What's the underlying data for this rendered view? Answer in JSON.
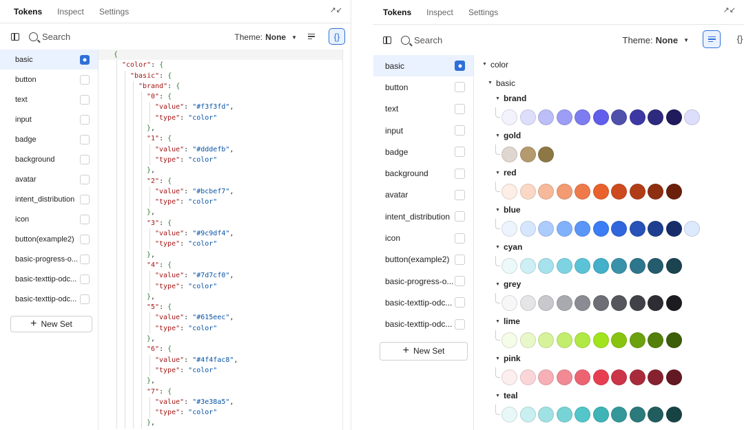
{
  "tabs": [
    "Tokens",
    "Inspect",
    "Settings"
  ],
  "toolbar": {
    "search_placeholder": "Search",
    "theme_label": "Theme:",
    "theme_value": "None"
  },
  "sets": [
    "basic",
    "button",
    "text",
    "input",
    "badge",
    "background",
    "avatar",
    "intent_distribution",
    "icon",
    "button(example2)",
    "basic-progress-o...",
    "basic-texttip-odc...",
    "basic-texttip-odc..."
  ],
  "active_set": "basic",
  "new_set_label": "New Set",
  "json_lines": [
    [
      {
        "t": "p",
        "v": "{"
      }
    ],
    [
      {
        "t": "k",
        "v": "\"color\""
      },
      {
        "t": "n",
        "v": ": "
      },
      {
        "t": "p",
        "v": "{"
      }
    ],
    [
      {
        "t": "k",
        "v": "\"basic\""
      },
      {
        "t": "n",
        "v": ": "
      },
      {
        "t": "p",
        "v": "{"
      }
    ],
    [
      {
        "t": "k",
        "v": "\"brand\""
      },
      {
        "t": "n",
        "v": ": "
      },
      {
        "t": "p",
        "v": "{"
      }
    ],
    [
      {
        "t": "k",
        "v": "\"0\""
      },
      {
        "t": "n",
        "v": ": "
      },
      {
        "t": "p",
        "v": "{"
      }
    ],
    [
      {
        "t": "k",
        "v": "\"value\""
      },
      {
        "t": "n",
        "v": ": "
      },
      {
        "t": "s",
        "v": "\"#f3f3fd\""
      },
      {
        "t": "n",
        "v": ","
      }
    ],
    [
      {
        "t": "k",
        "v": "\"type\""
      },
      {
        "t": "n",
        "v": ": "
      },
      {
        "t": "s",
        "v": "\"color\""
      }
    ],
    [
      {
        "t": "p",
        "v": "}"
      },
      {
        "t": "n",
        "v": ","
      }
    ],
    [
      {
        "t": "k",
        "v": "\"1\""
      },
      {
        "t": "n",
        "v": ": "
      },
      {
        "t": "p",
        "v": "{"
      }
    ],
    [
      {
        "t": "k",
        "v": "\"value\""
      },
      {
        "t": "n",
        "v": ": "
      },
      {
        "t": "s",
        "v": "\"#dddefb\""
      },
      {
        "t": "n",
        "v": ","
      }
    ],
    [
      {
        "t": "k",
        "v": "\"type\""
      },
      {
        "t": "n",
        "v": ": "
      },
      {
        "t": "s",
        "v": "\"color\""
      }
    ],
    [
      {
        "t": "p",
        "v": "}"
      },
      {
        "t": "n",
        "v": ","
      }
    ],
    [
      {
        "t": "k",
        "v": "\"2\""
      },
      {
        "t": "n",
        "v": ": "
      },
      {
        "t": "p",
        "v": "{"
      }
    ],
    [
      {
        "t": "k",
        "v": "\"value\""
      },
      {
        "t": "n",
        "v": ": "
      },
      {
        "t": "s",
        "v": "\"#bcbef7\""
      },
      {
        "t": "n",
        "v": ","
      }
    ],
    [
      {
        "t": "k",
        "v": "\"type\""
      },
      {
        "t": "n",
        "v": ": "
      },
      {
        "t": "s",
        "v": "\"color\""
      }
    ],
    [
      {
        "t": "p",
        "v": "}"
      },
      {
        "t": "n",
        "v": ","
      }
    ],
    [
      {
        "t": "k",
        "v": "\"3\""
      },
      {
        "t": "n",
        "v": ": "
      },
      {
        "t": "p",
        "v": "{"
      }
    ],
    [
      {
        "t": "k",
        "v": "\"value\""
      },
      {
        "t": "n",
        "v": ": "
      },
      {
        "t": "s",
        "v": "\"#9c9df4\""
      },
      {
        "t": "n",
        "v": ","
      }
    ],
    [
      {
        "t": "k",
        "v": "\"type\""
      },
      {
        "t": "n",
        "v": ": "
      },
      {
        "t": "s",
        "v": "\"color\""
      }
    ],
    [
      {
        "t": "p",
        "v": "}"
      },
      {
        "t": "n",
        "v": ","
      }
    ],
    [
      {
        "t": "k",
        "v": "\"4\""
      },
      {
        "t": "n",
        "v": ": "
      },
      {
        "t": "p",
        "v": "{"
      }
    ],
    [
      {
        "t": "k",
        "v": "\"value\""
      },
      {
        "t": "n",
        "v": ": "
      },
      {
        "t": "s",
        "v": "\"#7d7cf0\""
      },
      {
        "t": "n",
        "v": ","
      }
    ],
    [
      {
        "t": "k",
        "v": "\"type\""
      },
      {
        "t": "n",
        "v": ": "
      },
      {
        "t": "s",
        "v": "\"color\""
      }
    ],
    [
      {
        "t": "p",
        "v": "}"
      },
      {
        "t": "n",
        "v": ","
      }
    ],
    [
      {
        "t": "k",
        "v": "\"5\""
      },
      {
        "t": "n",
        "v": ": "
      },
      {
        "t": "p",
        "v": "{"
      }
    ],
    [
      {
        "t": "k",
        "v": "\"value\""
      },
      {
        "t": "n",
        "v": ": "
      },
      {
        "t": "s",
        "v": "\"#615eec\""
      },
      {
        "t": "n",
        "v": ","
      }
    ],
    [
      {
        "t": "k",
        "v": "\"type\""
      },
      {
        "t": "n",
        "v": ": "
      },
      {
        "t": "s",
        "v": "\"color\""
      }
    ],
    [
      {
        "t": "p",
        "v": "}"
      },
      {
        "t": "n",
        "v": ","
      }
    ],
    [
      {
        "t": "k",
        "v": "\"6\""
      },
      {
        "t": "n",
        "v": ": "
      },
      {
        "t": "p",
        "v": "{"
      }
    ],
    [
      {
        "t": "k",
        "v": "\"value\""
      },
      {
        "t": "n",
        "v": ": "
      },
      {
        "t": "s",
        "v": "\"#4f4fac8\""
      },
      {
        "t": "n",
        "v": ","
      }
    ],
    [
      {
        "t": "k",
        "v": "\"type\""
      },
      {
        "t": "n",
        "v": ": "
      },
      {
        "t": "s",
        "v": "\"color\""
      }
    ],
    [
      {
        "t": "p",
        "v": "}"
      },
      {
        "t": "n",
        "v": ","
      }
    ],
    [
      {
        "t": "k",
        "v": "\"7\""
      },
      {
        "t": "n",
        "v": ": "
      },
      {
        "t": "p",
        "v": "{"
      }
    ],
    [
      {
        "t": "k",
        "v": "\"value\""
      },
      {
        "t": "n",
        "v": ": "
      },
      {
        "t": "s",
        "v": "\"#3e38a5\""
      },
      {
        "t": "n",
        "v": ","
      }
    ],
    [
      {
        "t": "k",
        "v": "\"type\""
      },
      {
        "t": "n",
        "v": ": "
      },
      {
        "t": "s",
        "v": "\"color\""
      }
    ],
    [
      {
        "t": "p",
        "v": "}"
      },
      {
        "t": "n",
        "v": ","
      }
    ]
  ],
  "tree": {
    "root": "color",
    "group": "basic",
    "palettes": [
      {
        "name": "brand",
        "colors": [
          "#f3f3fd",
          "#dddefb",
          "#bcbef7",
          "#9c9df4",
          "#7d7cf0",
          "#615eec",
          "#4f4fac",
          "#3e38a5",
          "#2e2a80",
          "#1f1b5c",
          "#dddefb"
        ]
      },
      {
        "name": "gold",
        "colors": [
          "#e0d6d0",
          "#b49a6e",
          "#8d7845"
        ]
      },
      {
        "name": "red",
        "colors": [
          "#fdeee6",
          "#fbd8c6",
          "#f6b999",
          "#f29a72",
          "#ee7a4a",
          "#e9612c",
          "#cd4a1e",
          "#b13d18",
          "#8e2f12",
          "#6b200c"
        ]
      },
      {
        "name": "blue",
        "colors": [
          "#eef4fe",
          "#d6e6fe",
          "#acccfd",
          "#82b1fb",
          "#5a96f8",
          "#3c7cf5",
          "#2f66dd",
          "#2752b7",
          "#1e3f90",
          "#162d6a",
          "#dde9fd"
        ]
      },
      {
        "name": "cyan",
        "colors": [
          "#ecf9fb",
          "#cdeff5",
          "#a5e2ec",
          "#7dd3e1",
          "#5cc3d6",
          "#44b0c9",
          "#3892aa",
          "#2e768b",
          "#245c6d",
          "#1b4350"
        ]
      },
      {
        "name": "grey",
        "colors": [
          "#f7f7f8",
          "#e5e5e8",
          "#c8c8cd",
          "#a9a9b0",
          "#8b8b93",
          "#6e6e77",
          "#56565e",
          "#414148",
          "#2d2d33",
          "#1c1c20"
        ]
      },
      {
        "name": "lime",
        "colors": [
          "#f5fce8",
          "#e8f8c8",
          "#d6f39b",
          "#c3ee6d",
          "#b1e944",
          "#a2e41c",
          "#88c40f",
          "#6ca20d",
          "#53800a",
          "#3d5e08"
        ]
      },
      {
        "name": "pink",
        "colors": [
          "#fdeeef",
          "#fbd6d9",
          "#f6b0b6",
          "#f18a94",
          "#ec6472",
          "#e73f52",
          "#cc3447",
          "#a92b3b",
          "#86222f",
          "#631923"
        ]
      },
      {
        "name": "teal",
        "colors": [
          "#e8f8f8",
          "#c9eff0",
          "#a0e2e3",
          "#77d4d6",
          "#52c6c8",
          "#3eb4b6",
          "#34979a",
          "#2b7a7c",
          "#215d5f",
          "#184344"
        ]
      }
    ]
  }
}
